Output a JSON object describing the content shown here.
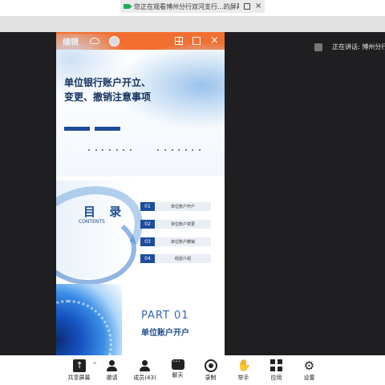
{
  "top_bar": {
    "notice_text": "您正在观看博州分行双河支行...的屏幕"
  },
  "speaker": {
    "label": "正在讲话: 博州分行"
  },
  "doc": {
    "title": "编辑"
  },
  "slides": {
    "cover": {
      "title_line1": "单位银行账户开立、",
      "title_line2": "变更、撤销注意事项"
    },
    "toc": {
      "heading": "目 录",
      "sub": "CONTENTS",
      "items": [
        {
          "num": "01",
          "label": "单位账户开户"
        },
        {
          "num": "02",
          "label": "单位账户变更"
        },
        {
          "num": "03",
          "label": "单位账户撤销"
        },
        {
          "num": "04",
          "label": "经验介绍"
        }
      ]
    },
    "part": {
      "part_label": "PART 01",
      "part_title": "单位账户开户"
    }
  },
  "toolbar": {
    "items": [
      {
        "label": "共享屏幕",
        "icon": "share-screen-icon"
      },
      {
        "label": "邀请",
        "icon": "invite-icon"
      },
      {
        "label": "成员(43)",
        "icon": "members-icon"
      },
      {
        "label": "聊天",
        "icon": "chat-icon"
      },
      {
        "label": "录制",
        "icon": "record-icon"
      },
      {
        "label": "举手",
        "icon": "raise-hand-icon"
      },
      {
        "label": "应用",
        "icon": "apps-icon"
      },
      {
        "label": "设置",
        "icon": "settings-icon"
      }
    ]
  },
  "colors": {
    "accent": "#f26f30",
    "slide_blue": "#1d4d9c",
    "background": "#1f1f21"
  }
}
